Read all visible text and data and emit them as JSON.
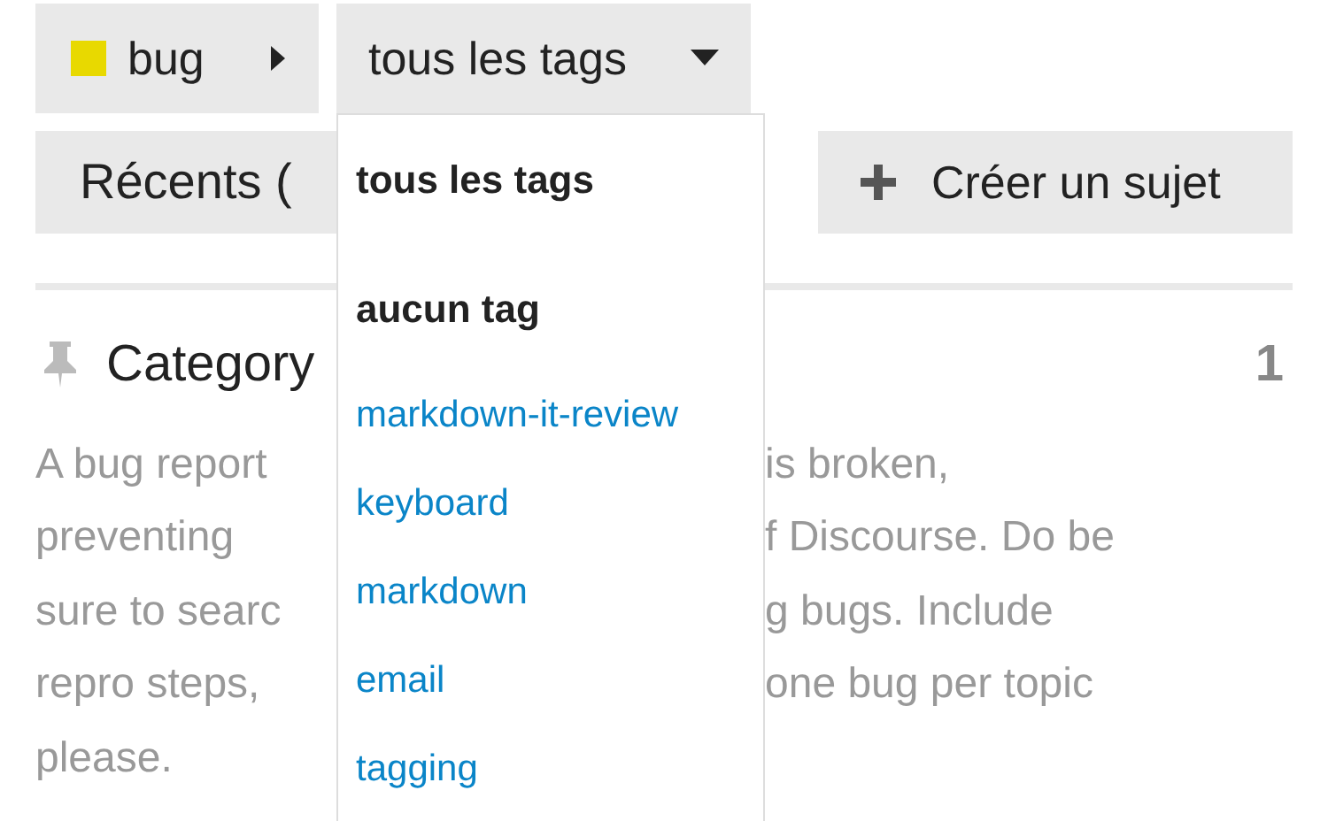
{
  "breadcrumbs": [
    {
      "label": "bug",
      "color": "#e8d900",
      "kind": "category"
    },
    {
      "label": "tous les tags",
      "kind": "tags",
      "expanded": true
    }
  ],
  "nav": {
    "tab": "Récents (",
    "create_button": "Créer un sujet"
  },
  "topic": {
    "title": "Category",
    "count": "1",
    "pinned": true,
    "excerpt_lines": [
      {
        "left": "A bug report",
        "right": "is broken,"
      },
      {
        "left": "preventing",
        "right": "f Discourse. Do be"
      },
      {
        "left": "sure to searc",
        "right": "g bugs. Include"
      },
      {
        "left": "repro steps,",
        "right": "one bug per topic"
      },
      {
        "left": "please."
      }
    ]
  },
  "tag_menu": [
    {
      "label": "tous les tags",
      "kind": "special"
    },
    {
      "label": "aucun tag",
      "kind": "special"
    },
    {
      "label": "markdown-it-review",
      "kind": "tag"
    },
    {
      "label": "keyboard",
      "kind": "tag"
    },
    {
      "label": "markdown",
      "kind": "tag"
    },
    {
      "label": "email",
      "kind": "tag"
    },
    {
      "label": "tagging",
      "kind": "tag"
    }
  ]
}
